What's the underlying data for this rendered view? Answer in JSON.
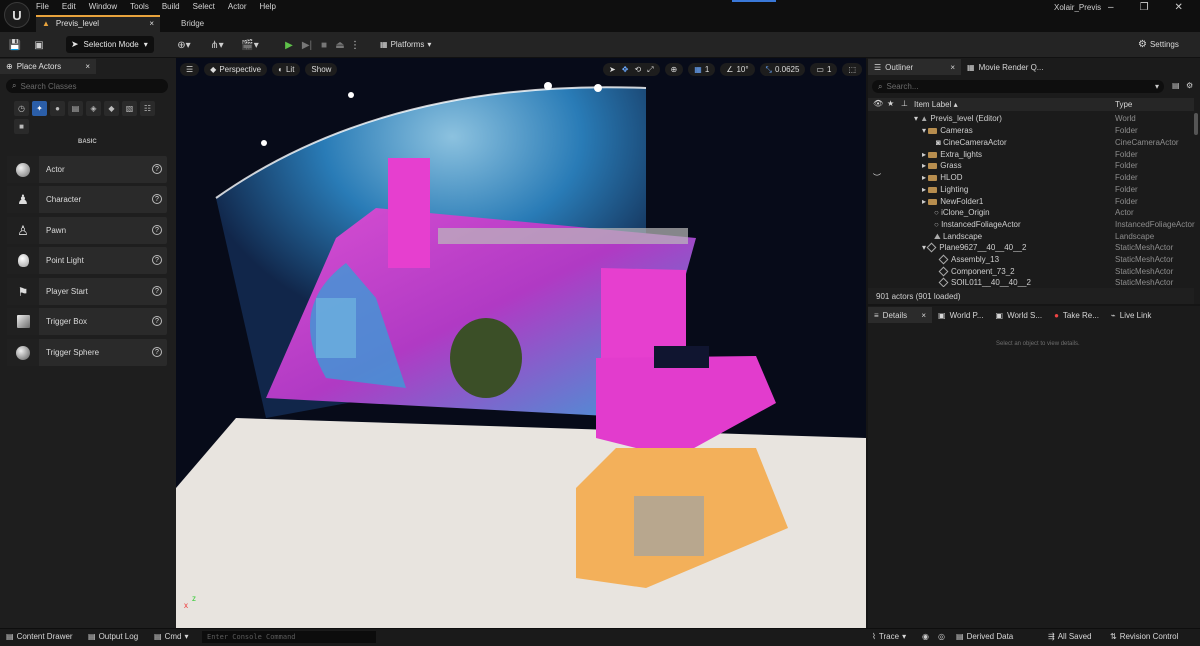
{
  "menu": [
    "File",
    "Edit",
    "Window",
    "Tools",
    "Build",
    "Select",
    "Actor",
    "Help"
  ],
  "tabs": {
    "level": "Previs_level",
    "bridge": "Bridge"
  },
  "project_name": "Xolair_Previs",
  "toolbar": {
    "mode": "Selection Mode",
    "platforms": "Platforms",
    "settings": "Settings"
  },
  "place_actors": {
    "title": "Place Actors",
    "search_placeholder": "Search Classes",
    "category_label": "BASIC",
    "items": [
      {
        "label": "Actor",
        "icon": "sphere-icon"
      },
      {
        "label": "Character",
        "icon": "character-icon"
      },
      {
        "label": "Pawn",
        "icon": "pawn-icon"
      },
      {
        "label": "Point Light",
        "icon": "light-bulb-icon"
      },
      {
        "label": "Player Start",
        "icon": "player-start-icon"
      },
      {
        "label": "Trigger Box",
        "icon": "cube-icon"
      },
      {
        "label": "Trigger Sphere",
        "icon": "sphere-icon"
      }
    ]
  },
  "viewport": {
    "perspective": "Perspective",
    "lit": "Lit",
    "show": "Show",
    "rotation_snap": "10°",
    "scale_snap": "0.0625",
    "grid": "1",
    "camera_speed": "1"
  },
  "outliner": {
    "tab": "Outliner",
    "tab2": "Movie Render Q...",
    "search_placeholder": "Search...",
    "col_label": "Item Label ▴",
    "col_type": "Type",
    "rows": [
      {
        "name": "Previs_level (Editor)",
        "type": "World",
        "indent": 2,
        "kind": "world"
      },
      {
        "name": "Cameras",
        "type": "Folder",
        "indent": 3,
        "kind": "folder-open"
      },
      {
        "name": "CineCameraActor",
        "type": "CineCameraActor",
        "indent": 4,
        "kind": "camera"
      },
      {
        "name": "Extra_lights",
        "type": "Folder",
        "indent": 3,
        "kind": "folder"
      },
      {
        "name": "Grass",
        "type": "Folder",
        "indent": 3,
        "kind": "folder"
      },
      {
        "name": "HLOD",
        "type": "Folder",
        "indent": 3,
        "kind": "folder"
      },
      {
        "name": "Lighting",
        "type": "Folder",
        "indent": 3,
        "kind": "folder"
      },
      {
        "name": "NewFolder1",
        "type": "Folder",
        "indent": 3,
        "kind": "folder"
      },
      {
        "name": "iClone_Origin",
        "type": "Actor",
        "indent": 3,
        "kind": "actor"
      },
      {
        "name": "InstancedFoliageActor",
        "type": "InstancedFoliageActor",
        "indent": 3,
        "kind": "actor"
      },
      {
        "name": "Landscape",
        "type": "Landscape",
        "indent": 3,
        "kind": "landscape"
      },
      {
        "name": "Plane9627__40__40__2",
        "type": "StaticMeshActor",
        "indent": 3,
        "kind": "mesh-open"
      },
      {
        "name": "Assembly_13",
        "type": "StaticMeshActor",
        "indent": 4,
        "kind": "mesh"
      },
      {
        "name": "Component_73_2",
        "type": "StaticMeshActor",
        "indent": 4,
        "kind": "mesh"
      },
      {
        "name": "SOIL011__40__40__2",
        "type": "StaticMeshActor",
        "indent": 4,
        "kind": "mesh"
      }
    ],
    "status": "901 actors (901 loaded)"
  },
  "details": {
    "tabs": [
      "Details",
      "World P...",
      "World S...",
      "Take Re...",
      "Live Link"
    ],
    "hint": "Select an object to view details."
  },
  "statusbar": {
    "content_drawer": "Content Drawer",
    "output_log": "Output Log",
    "cmd": "Cmd",
    "console_placeholder": "Enter Console Command",
    "trace": "Trace",
    "derived_data": "Derived Data",
    "all_saved": "All Saved",
    "revision_control": "Revision Control"
  }
}
